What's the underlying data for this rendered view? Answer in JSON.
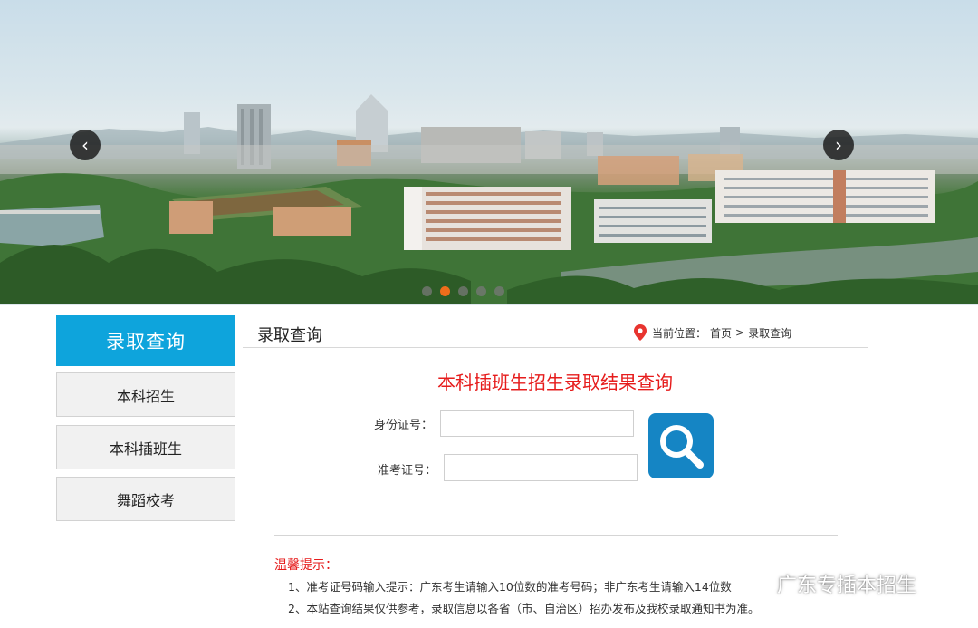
{
  "banner": {
    "prev_glyph": "‹",
    "next_glyph": "›",
    "slide_count": 5,
    "active_slide": 2
  },
  "sidebar": {
    "title": "录取查询",
    "items": [
      {
        "label": "本科招生"
      },
      {
        "label": "本科插班生"
      },
      {
        "label": "舞蹈校考"
      }
    ]
  },
  "main": {
    "title": "录取查询",
    "breadcrumb": {
      "prefix": "当前位置：",
      "home": "首页",
      "separator": ">",
      "current": "录取查询"
    },
    "query_title": "本科插班生招生录取结果查询",
    "form": {
      "id_label": "身份证号：",
      "id_value": "",
      "exam_label": "准考证号：",
      "exam_value": ""
    },
    "tips": {
      "title": "温馨提示：",
      "lines": [
        "1、准考证号码输入提示：广东考生请输入10位数的准考号码；非广东考生请输入14位数",
        "2、本站查询结果仅供参考，录取信息以各省（市、自治区）招办发布及我校录取通知书为准。"
      ]
    }
  },
  "watermark": {
    "text": "广东专插本招生"
  },
  "colors": {
    "accent_blue": "#0ea4dc",
    "search_blue": "#1585c4",
    "alert_red": "#e61c1c",
    "dot_active": "#ee6d1b"
  }
}
